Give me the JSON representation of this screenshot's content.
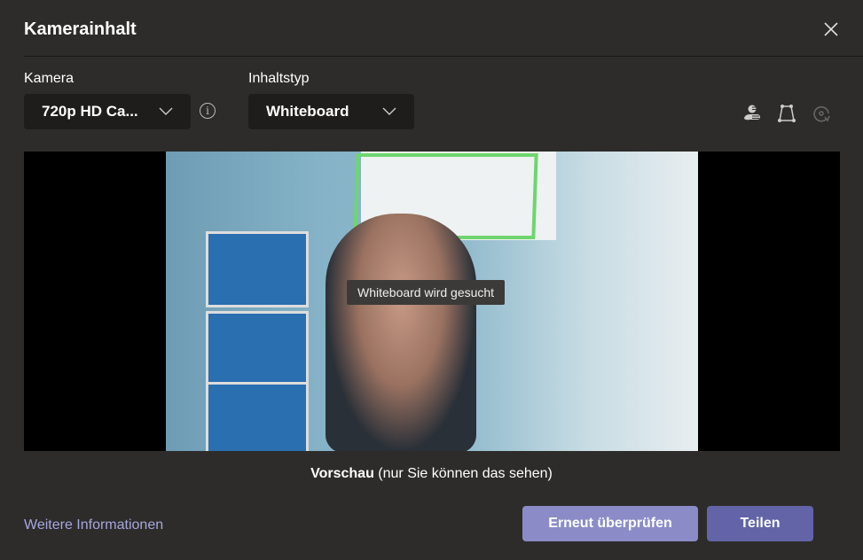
{
  "dialog": {
    "title": "Kamerainhalt",
    "close_icon": "close-icon"
  },
  "camera": {
    "label": "Kamera",
    "value": "720p HD Ca...",
    "info_icon": "info-icon"
  },
  "content_type": {
    "label": "Inhaltstyp",
    "value": "Whiteboard"
  },
  "tools": [
    {
      "name": "enhance-person-icon",
      "enabled": true
    },
    {
      "name": "crop-corners-icon",
      "enabled": true
    },
    {
      "name": "rotate-icon",
      "enabled": false
    }
  ],
  "preview": {
    "status_tooltip": "Whiteboard wird gesucht",
    "detection_color": "#6fd56f"
  },
  "caption": {
    "bold": "Vorschau",
    "rest": " (nur Sie können das sehen)"
  },
  "footer": {
    "more_info_link": "Weitere Informationen",
    "recheck_button": "Erneut überprüfen",
    "share_button": "Teilen"
  },
  "colors": {
    "background": "#2d2c2b",
    "accent": "#6264a7",
    "accent_light": "#8b8cc7",
    "link": "#a6a7dc"
  }
}
